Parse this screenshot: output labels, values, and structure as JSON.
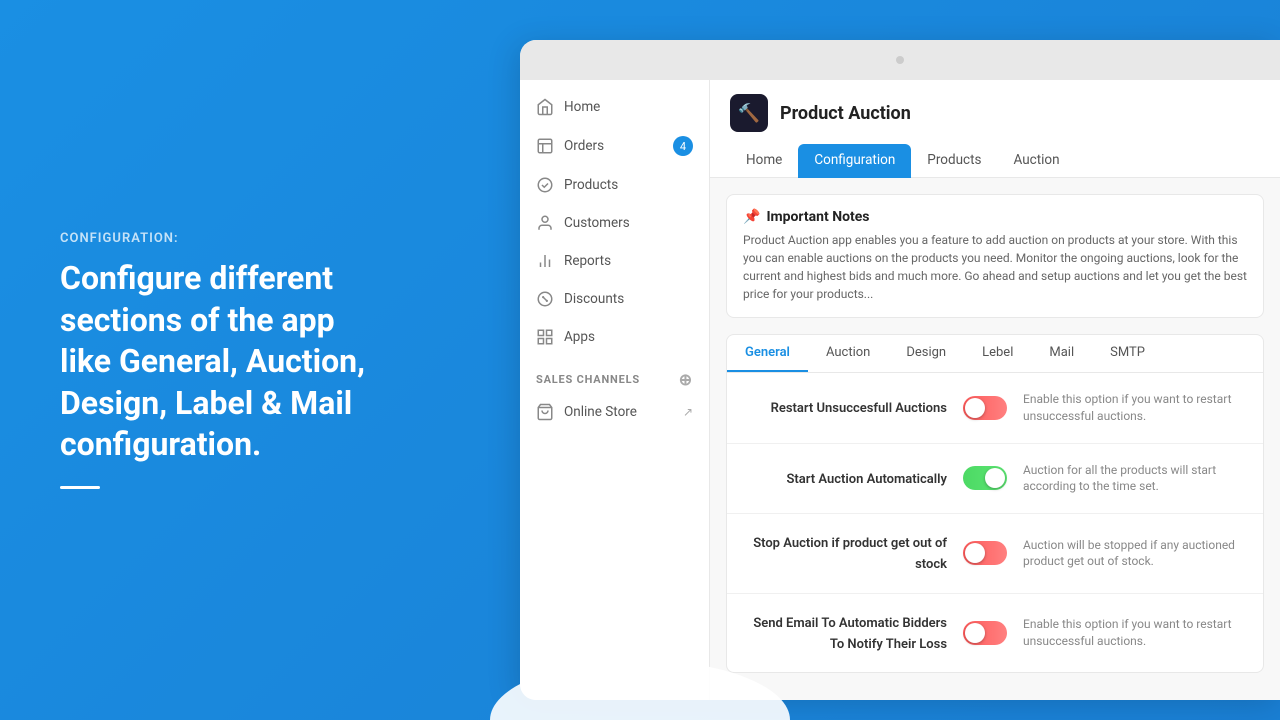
{
  "page": {
    "background_color": "#1a8fe3"
  },
  "left_panel": {
    "label": "CONFIGURATION:",
    "title": "Configure different sections of the app like General, Auction, Design, Label & Mail configuration."
  },
  "sidebar": {
    "items": [
      {
        "id": "home",
        "label": "Home",
        "icon": "home",
        "badge": null
      },
      {
        "id": "orders",
        "label": "Orders",
        "icon": "orders",
        "badge": "4"
      },
      {
        "id": "products",
        "label": "Products",
        "icon": "products",
        "badge": null
      },
      {
        "id": "customers",
        "label": "Customers",
        "icon": "customers",
        "badge": null
      },
      {
        "id": "reports",
        "label": "Reports",
        "icon": "reports",
        "badge": null
      },
      {
        "id": "discounts",
        "label": "Discounts",
        "icon": "discounts",
        "badge": null
      },
      {
        "id": "apps",
        "label": "Apps",
        "icon": "apps",
        "badge": null
      }
    ],
    "sales_channels_label": "SALES CHANNELS",
    "sales_channels": [
      {
        "id": "online-store",
        "label": "Online Store",
        "external": true
      }
    ]
  },
  "app_header": {
    "logo_emoji": "🔨",
    "title": "Product Auction",
    "nav_items": [
      {
        "id": "home",
        "label": "Home",
        "active": false
      },
      {
        "id": "configuration",
        "label": "Configuration",
        "active": true
      },
      {
        "id": "products",
        "label": "Products",
        "active": false
      },
      {
        "id": "auction",
        "label": "Auction",
        "active": false
      }
    ]
  },
  "notes": {
    "icon": "📌",
    "title": "Important Notes",
    "text": "Product Auction app enables you a feature to add auction on products at your store. With this you can enable auctions on the products you need. Monitor the ongoing auctions, look for the current and highest bids and much more. Go ahead and setup auctions and let you get the best price for your products..."
  },
  "config_tabs": [
    {
      "id": "general",
      "label": "General",
      "active": true
    },
    {
      "id": "auction",
      "label": "Auction",
      "active": false
    },
    {
      "id": "design",
      "label": "Design",
      "active": false
    },
    {
      "id": "lebel",
      "label": "Lebel",
      "active": false
    },
    {
      "id": "mail",
      "label": "Mail",
      "active": false
    },
    {
      "id": "smtp",
      "label": "SMTP",
      "active": false
    }
  ],
  "settings": [
    {
      "id": "restart-unsuccessful",
      "label": "Restart Unsuccesfull Auctions",
      "description": "Enable this option if you want to restart unsuccessful auctions.",
      "toggle_state": "off"
    },
    {
      "id": "start-automatically",
      "label": "Start Auction Automatically",
      "description": "Auction for all the products will start according to the time set.",
      "toggle_state": "on"
    },
    {
      "id": "stop-out-of-stock",
      "label": "Stop Auction if product get out of stock",
      "description": "Auction will be stopped if any auctioned product get out of stock.",
      "toggle_state": "off"
    },
    {
      "id": "send-email-bidders",
      "label": "Send Email To Automatic Bidders To Notify Their Loss",
      "description": "Enable this option if you want to restart unsuccessful auctions.",
      "toggle_state": "off"
    }
  ]
}
